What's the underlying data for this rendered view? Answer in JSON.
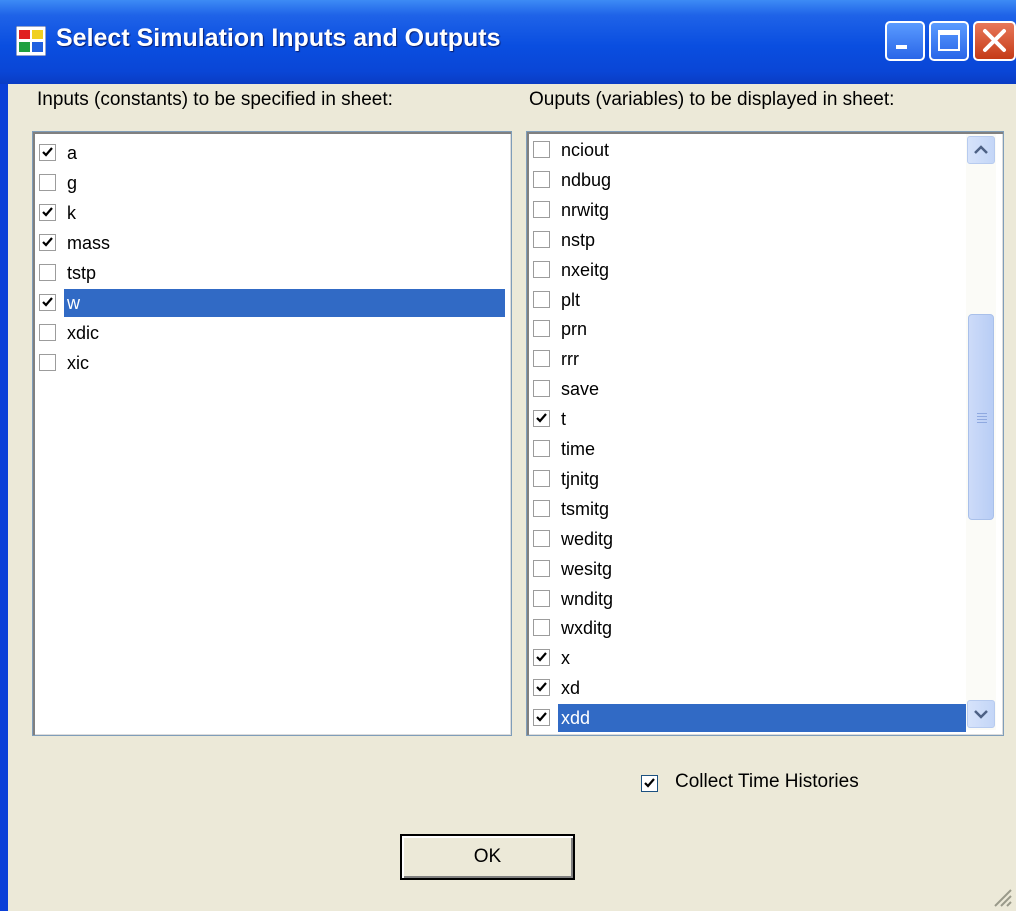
{
  "window": {
    "title": "Select Simulation Inputs and Outputs",
    "icon": "app-window-icon",
    "controls": [
      "minimize-icon",
      "maximize-icon",
      "close-icon"
    ]
  },
  "inputs": {
    "label": "Inputs (constants) to be specified in sheet:",
    "items": [
      {
        "name": "a",
        "checked": true,
        "selected": false
      },
      {
        "name": "g",
        "checked": false,
        "selected": false
      },
      {
        "name": "k",
        "checked": true,
        "selected": false
      },
      {
        "name": "mass",
        "checked": true,
        "selected": false
      },
      {
        "name": "tstp",
        "checked": false,
        "selected": false
      },
      {
        "name": "w",
        "checked": true,
        "selected": true
      },
      {
        "name": "xdic",
        "checked": false,
        "selected": false
      },
      {
        "name": "xic",
        "checked": false,
        "selected": false
      }
    ]
  },
  "outputs": {
    "label": "Ouputs (variables) to be displayed in sheet:",
    "items": [
      {
        "name": "nciout",
        "checked": false,
        "selected": false
      },
      {
        "name": "ndbug",
        "checked": false,
        "selected": false
      },
      {
        "name": "nrwitg",
        "checked": false,
        "selected": false
      },
      {
        "name": "nstp",
        "checked": false,
        "selected": false
      },
      {
        "name": "nxeitg",
        "checked": false,
        "selected": false
      },
      {
        "name": "plt",
        "checked": false,
        "selected": false
      },
      {
        "name": "prn",
        "checked": false,
        "selected": false
      },
      {
        "name": "rrr",
        "checked": false,
        "selected": false
      },
      {
        "name": "save",
        "checked": false,
        "selected": false
      },
      {
        "name": "t",
        "checked": true,
        "selected": false
      },
      {
        "name": "time",
        "checked": false,
        "selected": false
      },
      {
        "name": "tjnitg",
        "checked": false,
        "selected": false
      },
      {
        "name": "tsmitg",
        "checked": false,
        "selected": false
      },
      {
        "name": "weditg",
        "checked": false,
        "selected": false
      },
      {
        "name": "wesitg",
        "checked": false,
        "selected": false
      },
      {
        "name": "wnditg",
        "checked": false,
        "selected": false
      },
      {
        "name": "wxditg",
        "checked": false,
        "selected": false
      },
      {
        "name": "x",
        "checked": true,
        "selected": false
      },
      {
        "name": "xd",
        "checked": true,
        "selected": false
      },
      {
        "name": "xdd",
        "checked": true,
        "selected": true
      }
    ],
    "scrollbar_icons": [
      "scroll-up-icon",
      "scroll-down-icon"
    ]
  },
  "collect": {
    "label": "Collect Time Histories",
    "checked": true
  },
  "ok_button": {
    "label": "OK"
  },
  "colors": {
    "titlebar": "#0a4ee0",
    "selection": "#316ac5",
    "dialog_face": "#ece9d8",
    "close_button": "#c53b17"
  }
}
